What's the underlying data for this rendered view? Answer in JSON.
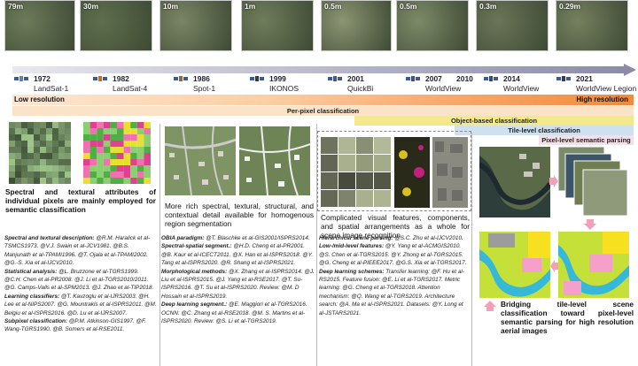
{
  "thumbnails": [
    {
      "res": "79m",
      "color": "#6d7a5a"
    },
    {
      "res": "30m",
      "color": "#5f6e4d"
    },
    {
      "res": "10m",
      "color": "#7a8566"
    },
    {
      "res": "1m",
      "color": "#6f7d5c"
    },
    {
      "res": "0.5m",
      "color": "#8b9573"
    },
    {
      "res": "0.5m",
      "color": "#7d8a68"
    },
    {
      "res": "0.3m",
      "color": "#6a7558"
    },
    {
      "res": "0.29m",
      "color": "#75805f"
    }
  ],
  "timeline": [
    {
      "year": "1972",
      "sat": "LandSat-1"
    },
    {
      "year": "1982",
      "sat": "LandSat-4"
    },
    {
      "year": "1986",
      "sat": "Spot-1"
    },
    {
      "year": "1999",
      "sat": "IKONOS"
    },
    {
      "year": "2001",
      "sat": "QuickBi"
    },
    {
      "year": "2007",
      "sat": "WorldView"
    },
    {
      "year": "2010",
      "sat": ""
    },
    {
      "year": "2014",
      "sat": "WorldView"
    },
    {
      "year": "2021",
      "sat": "WorldView Legion"
    }
  ],
  "resolution": {
    "low": "Low resolution",
    "high": "High resolution"
  },
  "bands": {
    "perpixel": "Per-pixel classification",
    "object": "Object-based classification",
    "tile": "Tile-level classification",
    "pixelsem": "Pixel-level semantic parsing"
  },
  "panels": {
    "p1_text": "Spectral and textural attributes of individual pixels are mainly employed for semantic classification",
    "p2_text": "More rich spectral, textural, structural, and contextual detail available for homogenous region segmentation",
    "p3_text": "Complicated visual features, components, and spatial arrangements as a whole for scene image recognition",
    "p4_text": "Bridging tile-level scene classification toward pixel-level semantic parsing for high resolution aerial images"
  },
  "refs": {
    "c1": [
      {
        "h": "Spectral and textural description:",
        "t": " @R.M. Haralick et al-TSMCS1973. @V.J. Swain et al-JCV1981. @B.S. Manjunath et al-TPAMI1996. @T. Ojala et al-TPAMI2002. @G.-S. Xia et al-IJCV2010."
      },
      {
        "h": "Statistical analysis:",
        "t": " @L. Bruzzone et al-TGRS1999. @C.H. Chen et al-PR2008. @J. Li et al-TGRS2010/2011. @G. Camps-Valls et al-SPM2013. @J. Zhao et al-TIP2018."
      },
      {
        "h": "Learning classifiers:",
        "t": " @T. Kavzoglu et al-IJRS2003. @H. Lee et al-NIPS2007. @G. Mountrakis et al-ISPRS2011. @M. Belgiu et al-ISPRS2016. @D. Lu et al-IJRS2007."
      },
      {
        "h": "Subpixel classification:",
        "t": " @P.M. Atkinson-GIS1997. @F. Wang-TGRS1990. @B. Somers et al-RSE2011."
      }
    ],
    "c2": [
      {
        "h": "OBIA paradigm:",
        "t": " @T. Blaschke et al-GIS2001/ISPRS2014."
      },
      {
        "h": "Spectral-spatial segment.:",
        "t": " @H.D. Cheng et al-PR2001. @B. Kaur et al-ICECT2011. @X. Han et al-ISPRS2018. @Y. Tang et al-ISPRS2020. @R. Shang et al-ISPRS2021."
      },
      {
        "h": "Morphological methods:",
        "t": " @X. Zhang et al-ISPRS2014. @J. Liu et al-ISPRS2015. @J. Yang et al-RSE2017. @T. Su-ISPRS2016. @T. Su et al-ISPRS2020. Review: @M. D Hossain et al-ISPRS2019."
      },
      {
        "h": "Deep learning segment.:",
        "t": " @E. Maggiori et al-TGRS2016. OCNN: @C. Zhang et al-RSE2018. @M. S. Martins et al-ISPRS2020. Review: @S. Li et al-TGRS2019."
      }
    ],
    "c3": [
      {
        "h": "Hierarchical scene parsing:",
        "t": " @S.C. Zhu et al-IJCV2010."
      },
      {
        "h": "Low-/mid-level features:",
        "t": " @Y. Yang et al-ACMGIS2010. @S. Chen et al-TGRS2015. @Y. Zhong et al-TGRS2015. @G. Cheng et al-PIEEE2017. @G.S. Xia et al-TGRS2017."
      },
      {
        "h": "Deep learning schemes:",
        "t": " Transfer learning: @F. Hu et al-RS2015. Feature fusion: @E. Li et al-TGRS2017. Metric learning: @G. Cheng et al-TGRS2018. Attention mechanism: @Q. Wang et al-TGRS2019. Architecture search: @A. Ma et al-ISPRS2021. Datasets: @Y. Long et al-JSTARS2021."
      }
    ]
  }
}
